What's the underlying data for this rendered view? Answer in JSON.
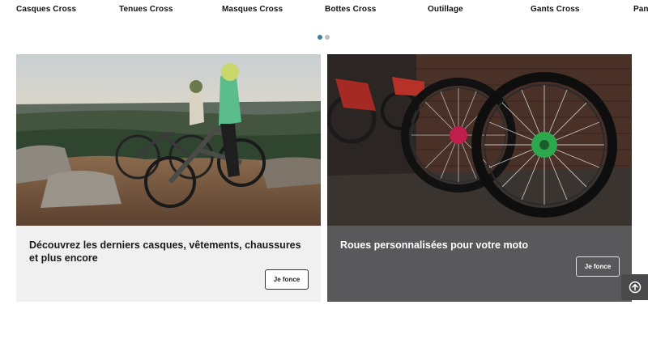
{
  "nav": {
    "categories": [
      "Casques Cross",
      "Tenues Cross",
      "Masques Cross",
      "Bottes Cross",
      "Outillage",
      "Gants Cross",
      "Pan"
    ]
  },
  "carousel": {
    "slide_count": 2,
    "active_index": 0,
    "active_color": "#3f7e97",
    "inactive_color": "#b9bcc0"
  },
  "cards": [
    {
      "title": "Découvrez les derniers casques, vêtements, chaussures et plus encore",
      "button": "Je fonce",
      "background": "#f0f0f1"
    },
    {
      "title": "Roues personnalisées pour votre moto",
      "button": "Je fonce",
      "background": "#59595b"
    }
  ],
  "scroll_top": {
    "icon": "arrow-up-circle-icon"
  }
}
